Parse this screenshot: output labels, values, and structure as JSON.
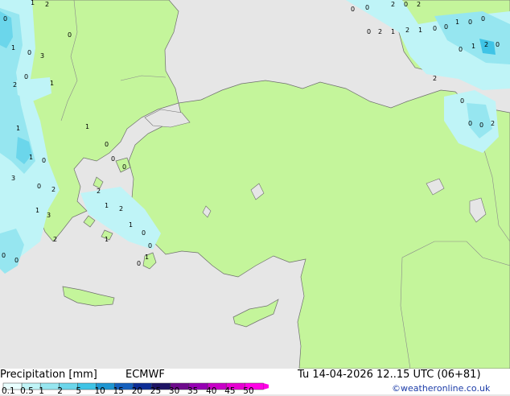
{
  "footer": {
    "title": "Precipitation [mm]",
    "model": "ECMWF",
    "valid_time": "Tu 14-04-2026 12..15 UTC (06+81)",
    "credit": "©weatheronline.co.uk"
  },
  "colorscale": {
    "ticks": [
      "0.1",
      "0.5",
      "1",
      "2",
      "5",
      "10",
      "15",
      "20",
      "25",
      "30",
      "35",
      "40",
      "45",
      "50"
    ],
    "colors": [
      "#e8ffff",
      "#bff4f7",
      "#96e6f0",
      "#6bd6eb",
      "#3fc4e6",
      "#1e96d2",
      "#1560be",
      "#0d2d96",
      "#1e1464",
      "#6e0a8c",
      "#9600b4",
      "#c800c8",
      "#e600d2",
      "#ff00e6"
    ]
  },
  "map": {
    "land_color": "#c4f59b",
    "sea_color": "#e6e6e6",
    "precip_colors": [
      "#bff4f7",
      "#96e6f0",
      "#6bd6eb",
      "#3fc4e6"
    ],
    "labels": [
      "1",
      "2",
      "0",
      "0",
      "0",
      "3",
      "1",
      "2",
      "0",
      "1",
      "1",
      "1",
      "0",
      "3",
      "0",
      "2",
      "1",
      "3",
      "2",
      "0",
      "0",
      "0",
      "0",
      "2",
      "0",
      "2",
      "0",
      "2",
      "1",
      "2",
      "1",
      "0",
      "0",
      "1",
      "0",
      "0",
      "0",
      "1",
      "2",
      "0",
      "2",
      "0",
      "0",
      "0",
      "2",
      "1",
      "0",
      "0",
      "0",
      "2",
      "1",
      "2",
      "1",
      "0",
      "0",
      "1",
      "0",
      "1"
    ]
  }
}
